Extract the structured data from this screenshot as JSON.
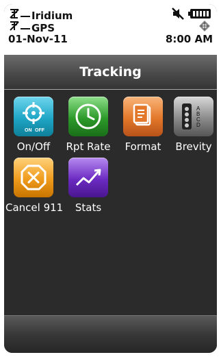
{
  "status": {
    "satellite_name": "Iridium",
    "gps_label": "GPS",
    "date": "01-Nov-11",
    "time": "8:00 AM",
    "icons": [
      "iridium-signal-icon",
      "gps-signal-icon",
      "mute-icon",
      "battery-icon",
      "gps-fix-icon"
    ]
  },
  "title": "Tracking",
  "apps": [
    {
      "label": "On/Off",
      "icon": "target-toggle-icon",
      "color": "#1fa6c6"
    },
    {
      "label": "Rpt Rate",
      "icon": "clock-icon",
      "color": "#2c9a2a"
    },
    {
      "label": "Format",
      "icon": "document-icon",
      "color": "#e3782a"
    },
    {
      "label": "Brevity",
      "icon": "brevity-code-icon",
      "color": "#8b8b8b"
    },
    {
      "label": "Cancel 911",
      "icon": "cancel-x-icon",
      "color": "#ef9b1c"
    },
    {
      "label": "Stats",
      "icon": "trend-chart-icon",
      "color": "#6b2bc2"
    }
  ]
}
